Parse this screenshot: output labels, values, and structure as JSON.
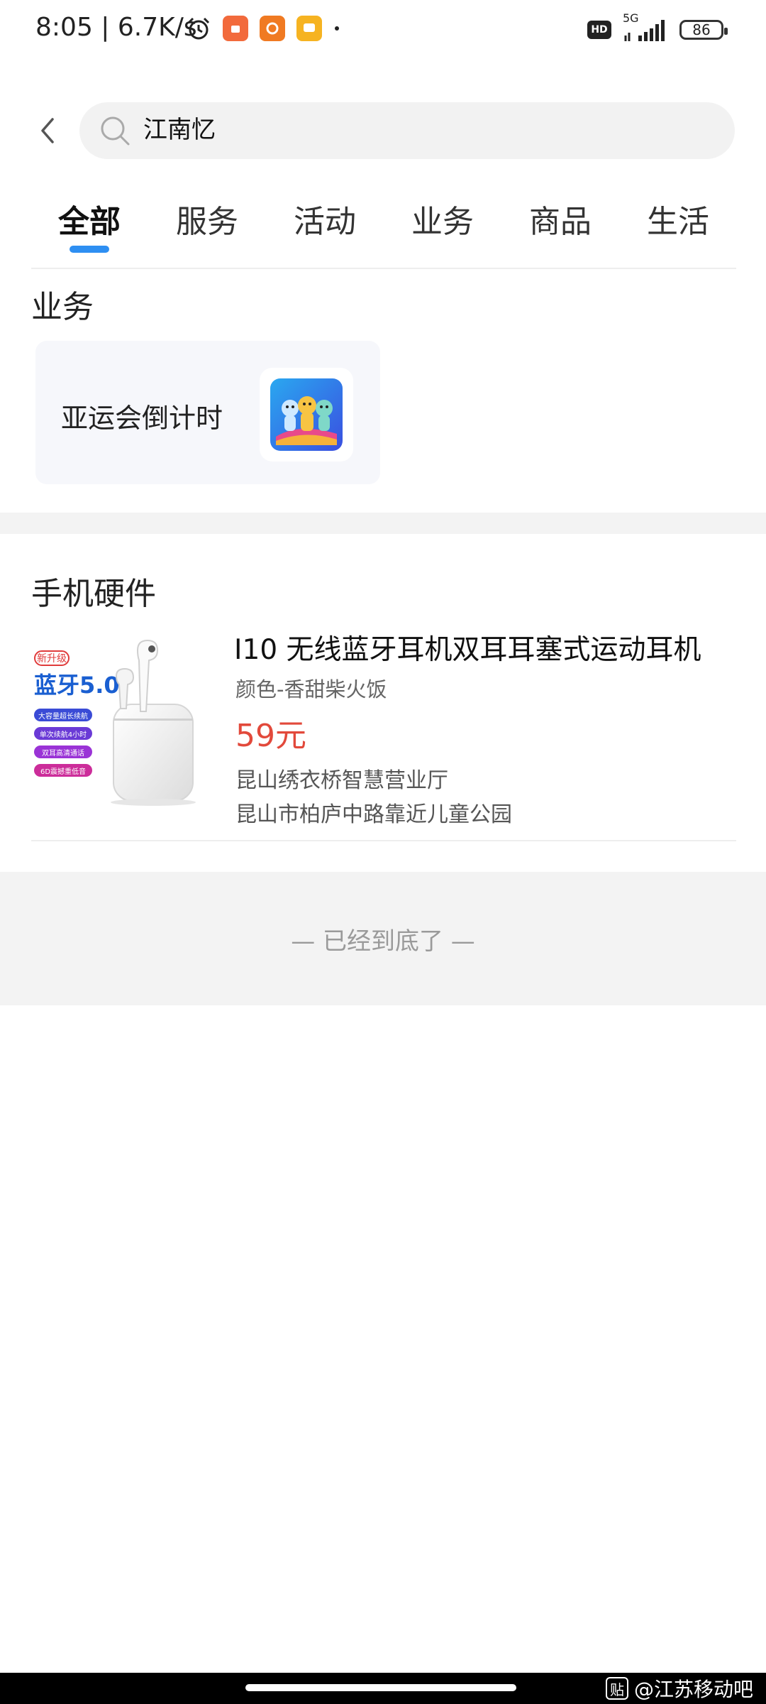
{
  "status_bar": {
    "time": "8:05 | 6.7K/s",
    "network": "5G",
    "hd": "HD",
    "battery": "86"
  },
  "header": {
    "search_query": "江南忆"
  },
  "tabs": [
    {
      "label": "全部",
      "active": true
    },
    {
      "label": "服务"
    },
    {
      "label": "活动"
    },
    {
      "label": "业务"
    },
    {
      "label": "商品"
    },
    {
      "label": "生活"
    }
  ],
  "business_section": {
    "title": "业务",
    "card": {
      "label": "亚运会倒计时"
    }
  },
  "hardware_section": {
    "title": "手机硬件",
    "product": {
      "title": "I10 无线蓝牙耳机双耳耳塞式运动耳机",
      "spec": "颜色-香甜柴火饭",
      "price": "59元",
      "store": "昆山绣衣桥智慧营业厅",
      "address": "昆山市柏庐中路靠近儿童公园",
      "image_text": {
        "badge": "新升级",
        "headline": "蓝牙5.0",
        "features": [
          "大容量超长续航",
          "单次续航4小时",
          "双耳高清通话",
          "6D震撼重低音"
        ]
      }
    }
  },
  "footer": {
    "end_text": "— 已经到底了 —"
  },
  "watermark": {
    "text": "@江苏移动吧",
    "icon_text": "贴"
  },
  "colors": {
    "accent": "#2e8ff2",
    "price": "#e2493b"
  }
}
